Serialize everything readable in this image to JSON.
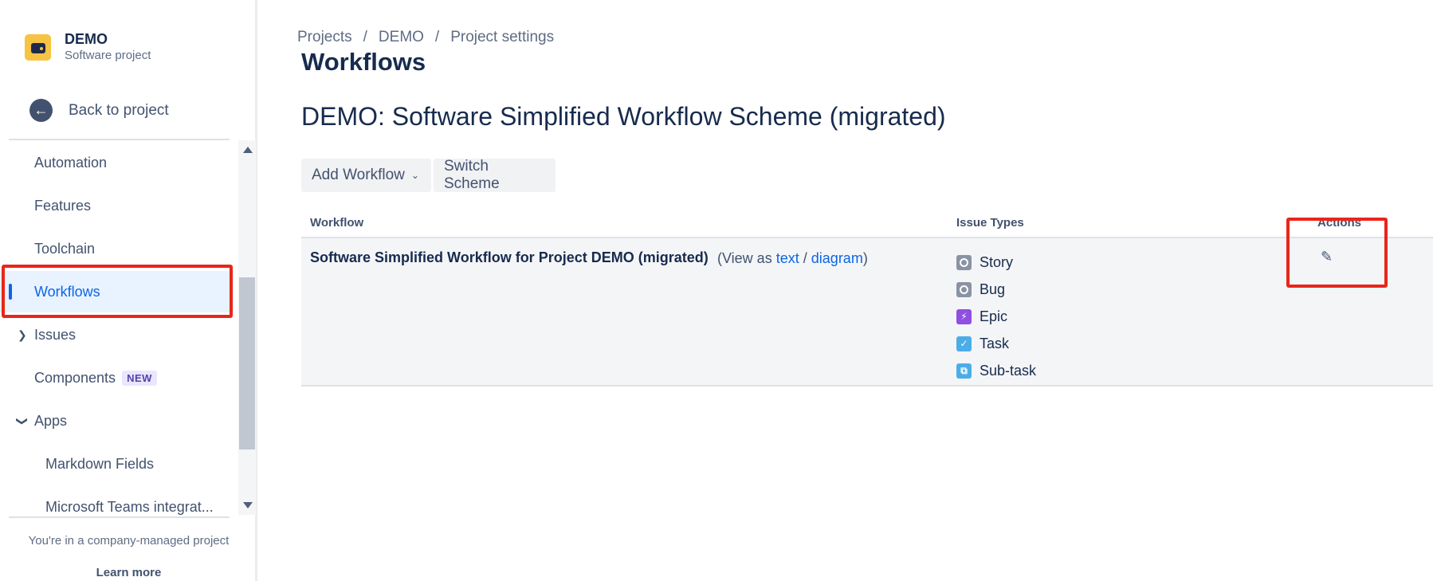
{
  "project": {
    "name": "DEMO",
    "type": "Software project"
  },
  "sidebar": {
    "back_label": "Back to project",
    "items": [
      {
        "label": "Automation"
      },
      {
        "label": "Features"
      },
      {
        "label": "Toolchain"
      },
      {
        "label": "Workflows",
        "active": true
      },
      {
        "label": "Issues",
        "chevron": "chevron-right"
      },
      {
        "label": "Components",
        "badge": "NEW"
      },
      {
        "label": "Apps",
        "chevron": "chevron-down"
      },
      {
        "label": "Markdown Fields"
      },
      {
        "label": "Microsoft Teams integrat..."
      }
    ],
    "footer_text": "You're in a company-managed project",
    "footer_link": "Learn more"
  },
  "breadcrumb": [
    "Projects",
    "DEMO",
    "Project settings"
  ],
  "page_title": "Workflows",
  "scheme_title": "DEMO: Software Simplified Workflow Scheme (migrated)",
  "toolbar": {
    "add_workflow": "Add Workflow",
    "switch_scheme": "Switch Scheme"
  },
  "table": {
    "headers": {
      "workflow": "Workflow",
      "issue_types": "Issue Types",
      "actions": "Actions"
    },
    "row": {
      "name": "Software Simplified Workflow for Project DEMO (migrated)",
      "view_prefix": "(View as",
      "text_link": "text",
      "slash": "/",
      "diagram_link": "diagram",
      "view_suffix": ")",
      "issue_types": [
        {
          "label": "Story",
          "icon": "story-icon"
        },
        {
          "label": "Bug",
          "icon": "bug-icon"
        },
        {
          "label": "Epic",
          "icon": "epic-icon"
        },
        {
          "label": "Task",
          "icon": "task-icon"
        },
        {
          "label": "Sub-task",
          "icon": "subtask-icon"
        }
      ],
      "action_icon": "pencil-icon"
    }
  },
  "colors": {
    "accent": "#0c66e4",
    "highlight": "#e8261b"
  }
}
